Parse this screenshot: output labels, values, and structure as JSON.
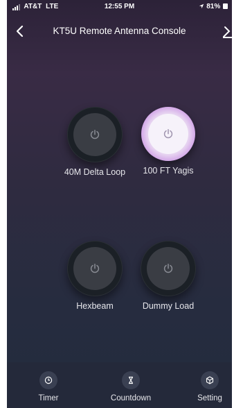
{
  "status_bar": {
    "carrier": "AT&T",
    "network": "LTE",
    "time": "12:55 PM",
    "battery": "81%"
  },
  "header": {
    "title": "KT5U Remote Antenna Console",
    "back_icon": "chevron-left-icon",
    "edit_icon": "pencil-icon"
  },
  "switches": [
    {
      "label": "40M Delta Loop",
      "state": "off"
    },
    {
      "label": "100 FT Yagis",
      "state": "on"
    },
    {
      "label": "Hexbeam",
      "state": "off"
    },
    {
      "label": "Dummy Load",
      "state": "off"
    }
  ],
  "tabs": [
    {
      "label": "Timer",
      "icon": "clock-icon"
    },
    {
      "label": "Countdown",
      "icon": "hourglass-icon"
    },
    {
      "label": "Setting",
      "icon": "cube-icon"
    }
  ],
  "colors": {
    "on_glow": "#c88fe3",
    "off_button": "#3a3d44",
    "background_top": "#2c2238",
    "background_bottom": "#232c3e"
  }
}
